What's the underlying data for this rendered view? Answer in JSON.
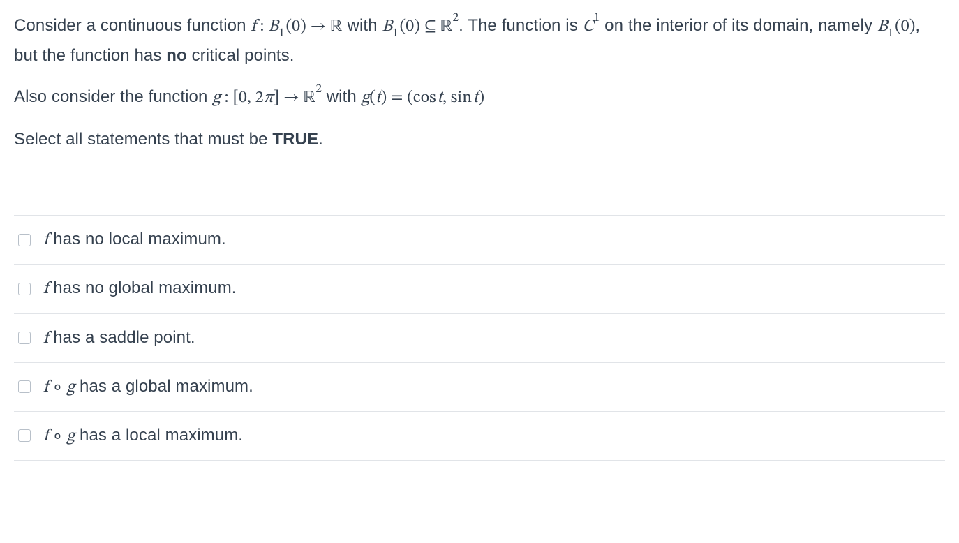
{
  "question": {
    "p1_before": "Consider a continuous function ",
    "p1_math1": "f : B̅₁(0) → ℝ",
    "p1_mid1": " with ",
    "p1_math2": "B₁(0) ⊆ ℝ²",
    "p1_mid2": ". The function is ",
    "p1_math3": "C¹",
    "p1_mid3": " on the interior of its domain, namely ",
    "p1_math4": "B₁(0)",
    "p1_mid4": ", but the function has ",
    "p1_bold": "no",
    "p1_after": " critical points.",
    "p2_before": "Also consider the function ",
    "p2_math1": "g : [0, 2π] → ℝ²",
    "p2_mid1": " with ",
    "p2_math2": "g(t) = (cos t, sin t)",
    "p3_before": "Select all statements that must be ",
    "p3_bold": "TRUE",
    "p3_after": "."
  },
  "options": {
    "a": {
      "math": "f",
      "text": " has no local maximum."
    },
    "b": {
      "math": "f",
      "text": " has no global maximum."
    },
    "c": {
      "math": "f",
      "text": " has a saddle point."
    },
    "d": {
      "math1": "f",
      "comp": " ∘ ",
      "math2": "g",
      "text": " has a global maximum."
    },
    "e": {
      "math1": "f",
      "comp": " ∘ ",
      "math2": "g",
      "text": " has a local maximum."
    }
  }
}
